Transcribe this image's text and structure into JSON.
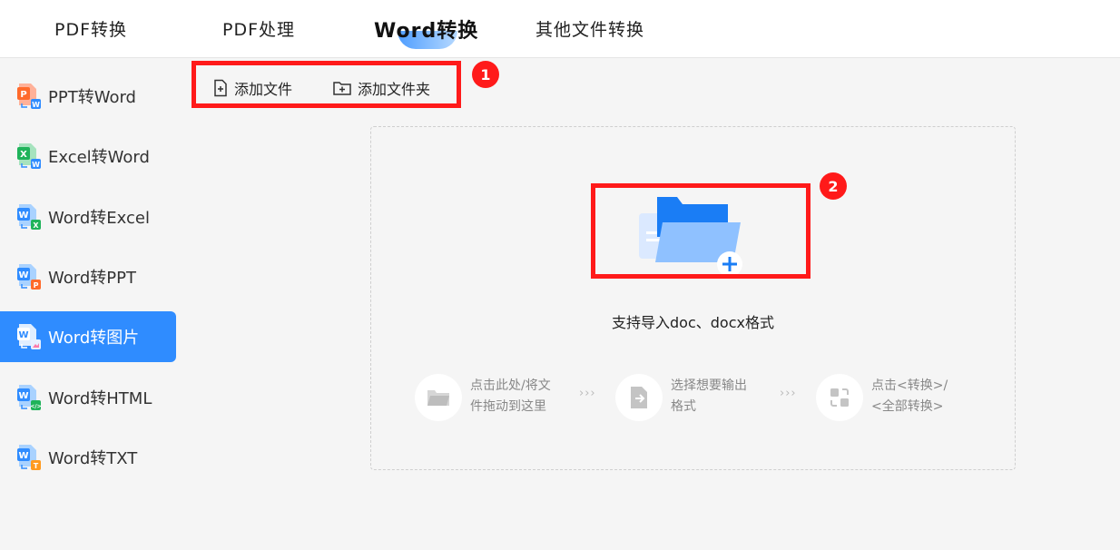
{
  "tabs": [
    {
      "label": "PDF转换"
    },
    {
      "label": "PDF处理"
    },
    {
      "label": "Word转换",
      "active": true
    },
    {
      "label": "其他文件转换"
    }
  ],
  "sidebar": {
    "items": [
      {
        "label": "PPT转Word",
        "icon": "ppt-to-word-icon"
      },
      {
        "label": "Excel转Word",
        "icon": "excel-to-word-icon"
      },
      {
        "label": "Word转Excel",
        "icon": "word-to-excel-icon"
      },
      {
        "label": "Word转PPT",
        "icon": "word-to-ppt-icon"
      },
      {
        "label": "Word转图片",
        "icon": "word-to-image-icon",
        "active": true
      },
      {
        "label": "Word转HTML",
        "icon": "word-to-html-icon"
      },
      {
        "label": "Word转TXT",
        "icon": "word-to-txt-icon"
      }
    ]
  },
  "toolbar": {
    "add_file": "添加文件",
    "add_folder": "添加文件夹"
  },
  "annotations": {
    "badge1": "1",
    "badge2": "2"
  },
  "dropzone": {
    "support_text": "支持导入doc、docx格式",
    "steps": [
      {
        "line1": "点击此处/将文",
        "line2": "件拖动到这里",
        "icon": "folder-icon"
      },
      {
        "line1": "选择想要输出",
        "line2": "格式",
        "icon": "file-export-icon"
      },
      {
        "line1": "点击<转换>/",
        "line2": "<全部转换>",
        "icon": "convert-icon"
      }
    ],
    "separator": "›››"
  },
  "colors": {
    "accent": "#2f8cff",
    "highlight": "#ff1a1a",
    "sidebar_bg": "#f5f5f5"
  }
}
